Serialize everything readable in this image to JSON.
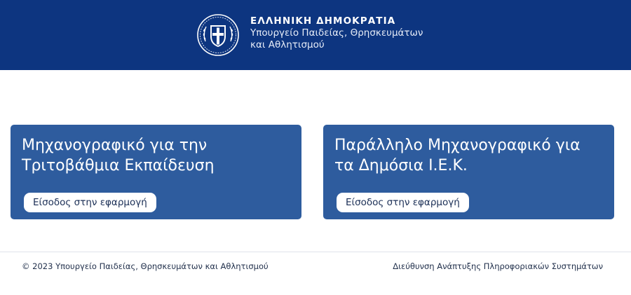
{
  "header": {
    "gov_name": "ΕΛΛΗΝΙΚΗ ΔΗΜΟΚΡΑΤΙΑ",
    "ministry_line1": "Υπουργείο Παιδείας, Θρησκευμάτων",
    "ministry_line2": "και Αθλητισμού",
    "logo_icon": "greek-coat-of-arms-icon"
  },
  "cards": [
    {
      "title_line1": "Μηχανογραφικό για την",
      "title_line2": "Τριτοβάθμια Εκπαίδευση",
      "button_label": "Είσοδος στην εφαρμογή"
    },
    {
      "title_line1": "Παράλληλο Μηχανογραφικό για",
      "title_line2": "τα Δημόσια Ι.Ε.Κ.",
      "button_label": "Είσοδος στην εφαρμογή"
    }
  ],
  "footer": {
    "copyright": "© 2023 Υπουργείο Παιδείας, Θρησκευμάτων και Αθλητισμού",
    "department": "Διεύθυνση Ανάπτυξης Πληροφοριακών Συστημάτων"
  },
  "colors": {
    "header_bg": "#0d3580",
    "card_bg": "#2e5c9e",
    "button_bg": "#ffffff",
    "footer_text": "#1f2e4a"
  }
}
